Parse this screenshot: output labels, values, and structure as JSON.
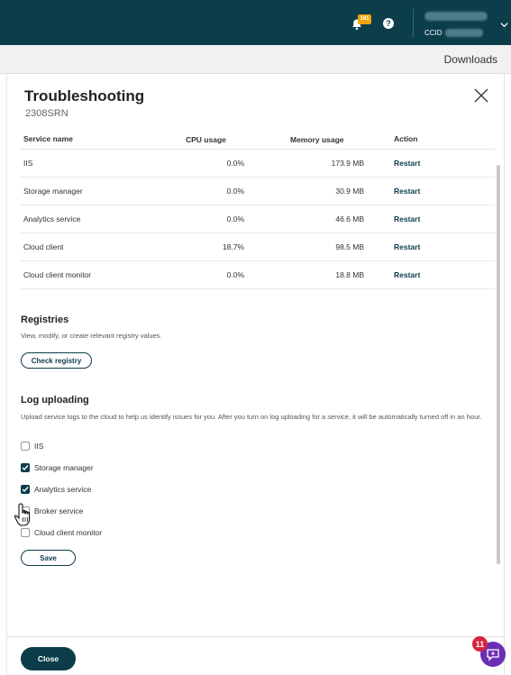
{
  "header": {
    "notification_count": "161",
    "account_label": "CCID",
    "colors": {
      "bar": "#0b3d4a",
      "badge": "#f0a30a"
    }
  },
  "subbar": {
    "downloads_label": "Downloads"
  },
  "panel": {
    "title": "Troubleshooting",
    "subtitle": "2308SRN"
  },
  "services_table": {
    "columns": [
      "Service name",
      "CPU usage",
      "Memory usage",
      "Action"
    ],
    "rows": [
      {
        "name": "IIS",
        "cpu": "0.0%",
        "memory": "173.9 MB",
        "action": "Restart"
      },
      {
        "name": "Storage manager",
        "cpu": "0.0%",
        "memory": "30.9 MB",
        "action": "Restart"
      },
      {
        "name": "Analytics service",
        "cpu": "0.0%",
        "memory": "46.6 MB",
        "action": "Restart"
      },
      {
        "name": "Cloud client",
        "cpu": "18.7%",
        "memory": "98.5 MB",
        "action": "Restart"
      },
      {
        "name": "Cloud client monitor",
        "cpu": "0.0%",
        "memory": "18.8 MB",
        "action": "Restart"
      }
    ]
  },
  "registries": {
    "title": "Registries",
    "description": "View, modify, or create relevant registry values.",
    "button_label": "Check registry"
  },
  "log_uploading": {
    "title": "Log uploading",
    "description": "Upload service logs to the cloud to help us identify issues for you. After you turn on log uploading for a service, it will be automatically turned off in an hour.",
    "items": [
      {
        "label": "IIS",
        "checked": false
      },
      {
        "label": "Storage manager",
        "checked": true
      },
      {
        "label": "Analytics service",
        "checked": true
      },
      {
        "label": "Broker service",
        "checked": false
      },
      {
        "label": "Cloud client monitor",
        "checked": false
      }
    ],
    "save_label": "Save"
  },
  "footer": {
    "close_label": "Close"
  },
  "help_widget": {
    "count": "11",
    "color": "#6b2fb5",
    "badge_color": "#d6253a"
  }
}
